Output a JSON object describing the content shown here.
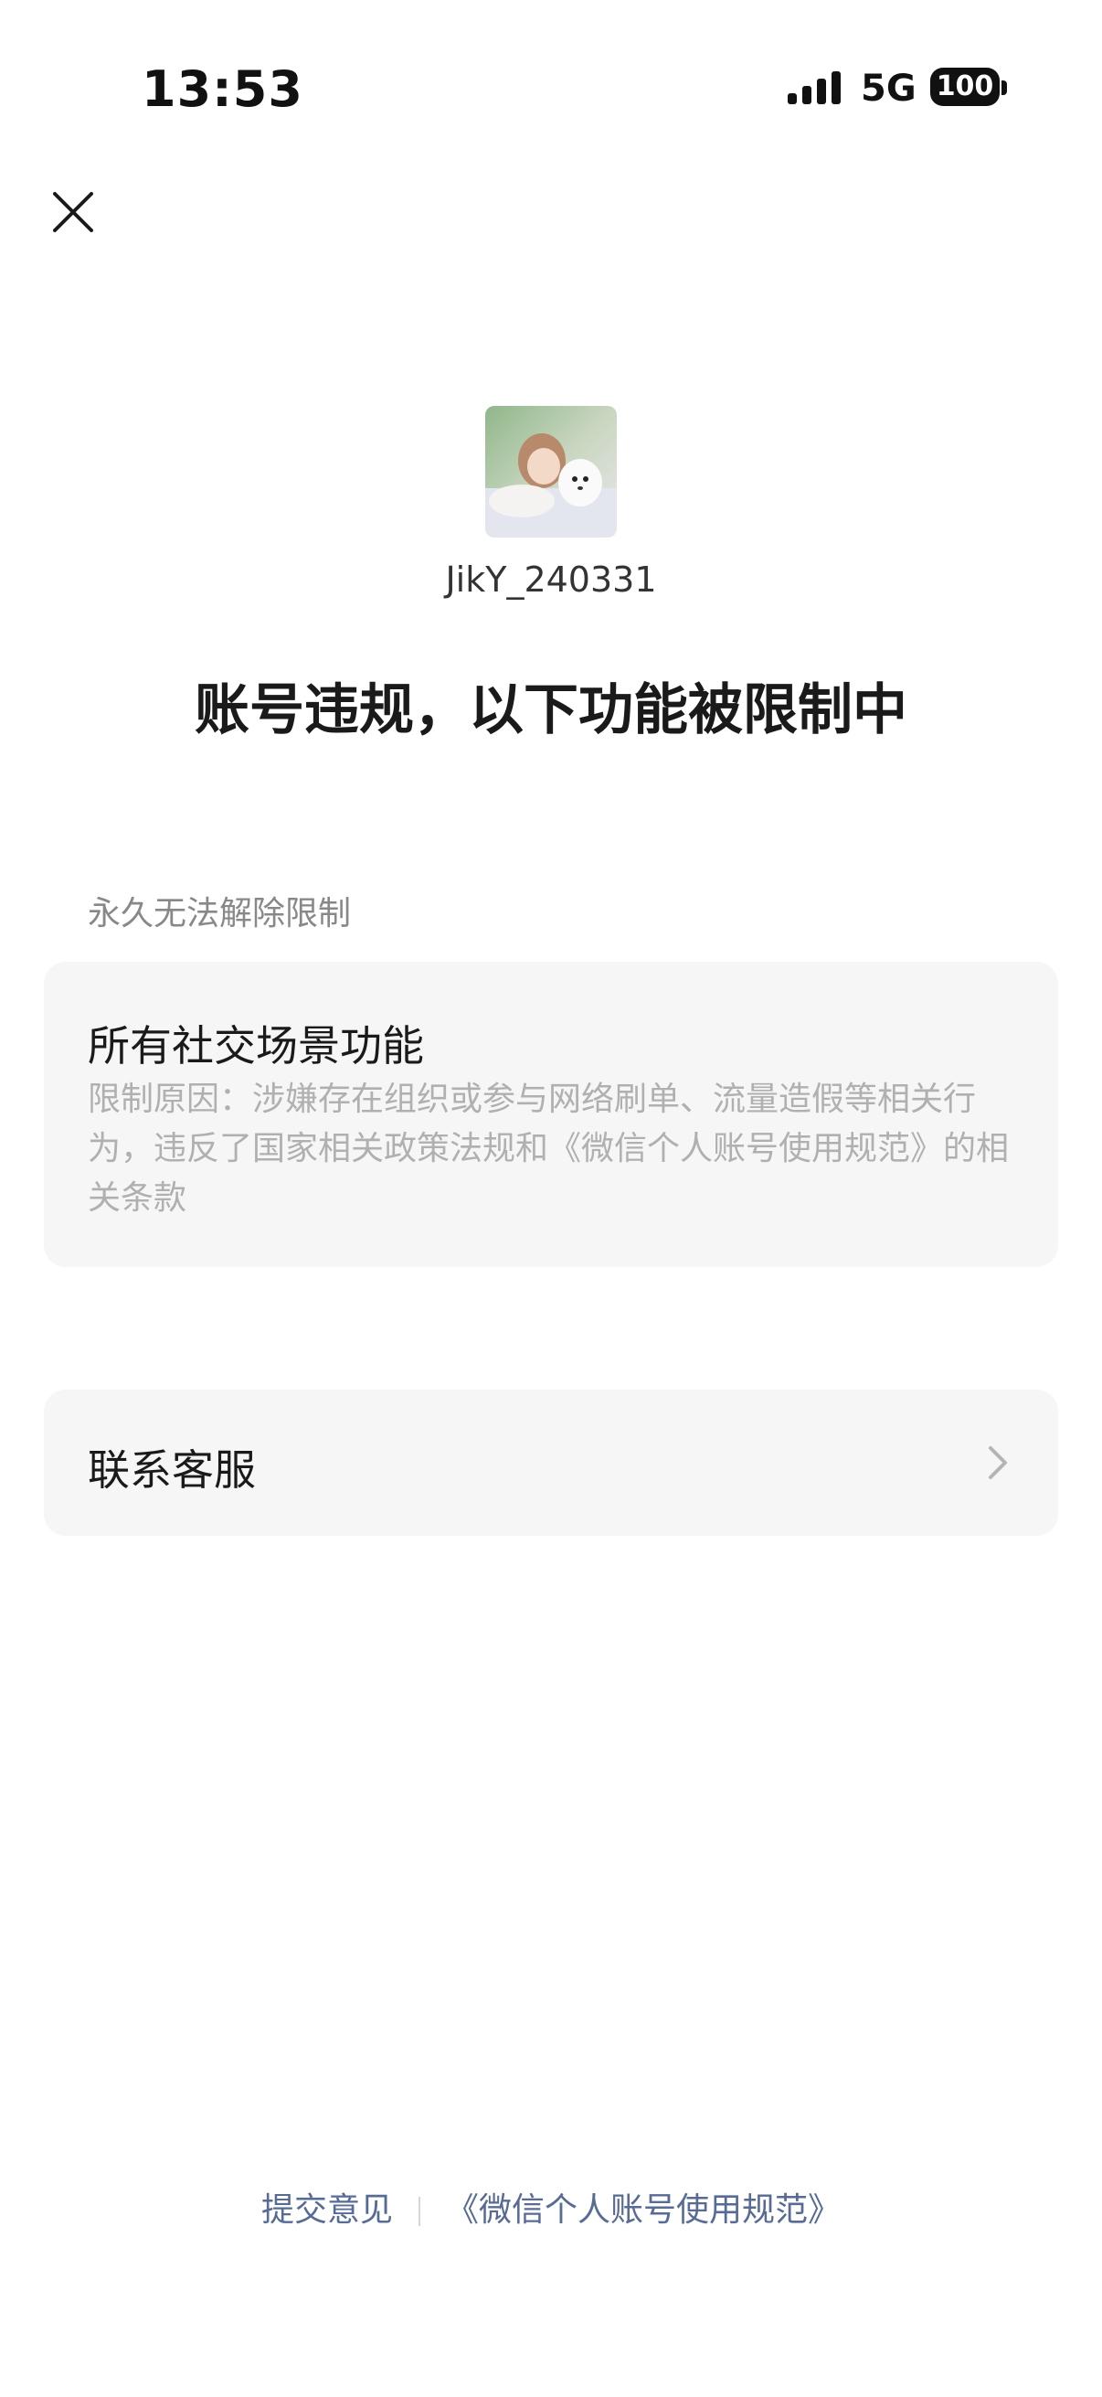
{
  "status_bar": {
    "time": "13:53",
    "network": "5G",
    "battery": "100"
  },
  "profile": {
    "username": "JikY_240331"
  },
  "headline": "账号违规，以下功能被限制中",
  "restriction": {
    "section_label": "永久无法解除限制",
    "title": "所有社交场景功能",
    "reason": "限制原因：涉嫌存在组织或参与网络刷单、流量造假等相关行为，违反了国家相关政策法规和《微信个人账号使用规范》的相关条款"
  },
  "service": {
    "label": "联系客服"
  },
  "footer": {
    "feedback": "提交意见",
    "policy": "《微信个人账号使用规范》"
  },
  "colors": {
    "link": "#576b95",
    "card_bg": "#f6f6f6",
    "muted_text": "#b0b0b0"
  }
}
